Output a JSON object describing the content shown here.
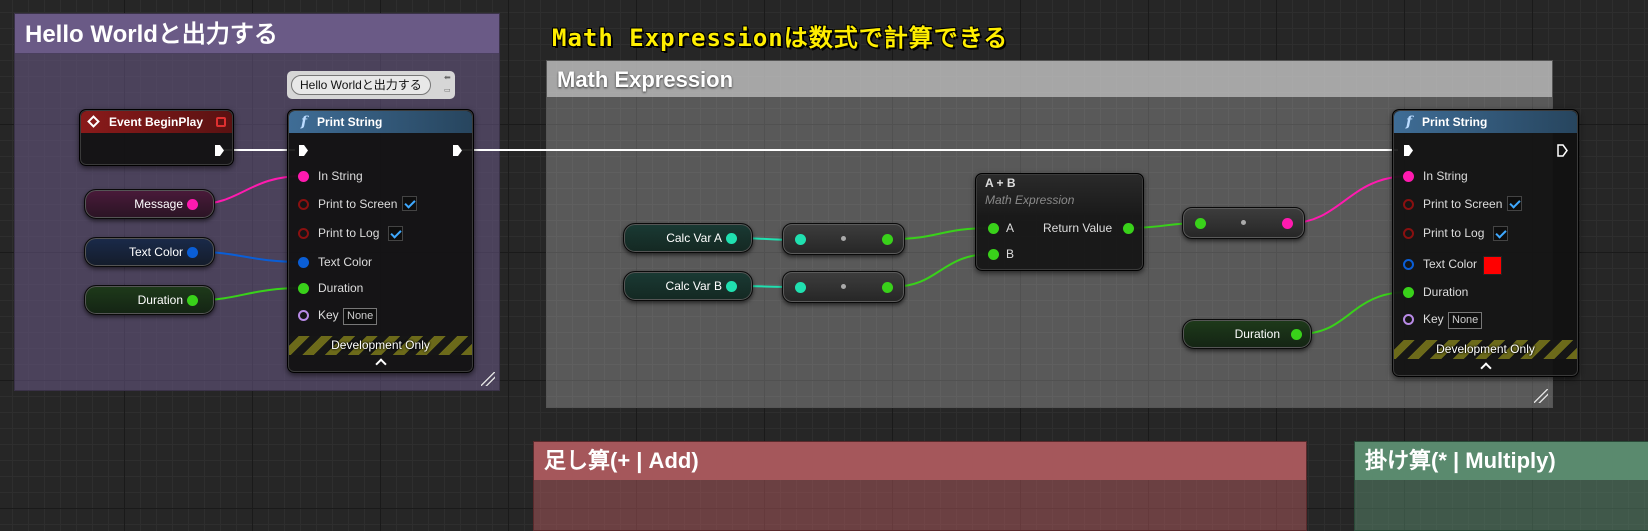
{
  "heading": {
    "text": "Math Expressionは数式で計算できる",
    "color": "#ffee00"
  },
  "comments": {
    "hello": {
      "title": "Hello Worldと出力する",
      "color": "#6a5a86"
    },
    "math": {
      "title": "Math Expression",
      "color": "#c8c8c8"
    },
    "add": {
      "title": "足し算(+ | Add)",
      "color": "#b05a5e"
    },
    "mul": {
      "title": "掛け算(* | Multiply)",
      "color": "#5a8a6e"
    }
  },
  "tooltip": {
    "text": "Hello Worldと出力する"
  },
  "event_node": {
    "title": "Event BeginPlay",
    "header_color": "#8a1a1a"
  },
  "print1": {
    "title": "Print String",
    "func_icon": "f",
    "in_string": "In String",
    "print_screen": "Print to Screen",
    "print_log": "Print to Log",
    "text_color": "Text Color",
    "duration": "Duration",
    "key": "Key",
    "key_value": "None",
    "dev_only": "Development Only"
  },
  "print2": {
    "title": "Print String",
    "func_icon": "f",
    "in_string": "In String",
    "print_screen": "Print to Screen",
    "print_log": "Print to Log",
    "text_color": "Text Color",
    "text_color_swatch": "#ff0000",
    "duration": "Duration",
    "key": "Key",
    "key_value": "None",
    "dev_only": "Development Only"
  },
  "vars": {
    "message": "Message",
    "text_color": "Text Color",
    "duration": "Duration",
    "calc_a": "Calc Var A",
    "calc_b": "Calc Var B",
    "duration2": "Duration"
  },
  "math_node": {
    "title": "A + B",
    "subtitle": "Math Expression",
    "pin_a": "A",
    "pin_b": "B",
    "return_value": "Return Value"
  },
  "colors": {
    "string": "#ff1aaf",
    "linear_color": "#0a5ed6",
    "float": "#39d11a",
    "teal": "#20e0b0",
    "key": "#b88ae6",
    "exec": "#ffffff"
  }
}
